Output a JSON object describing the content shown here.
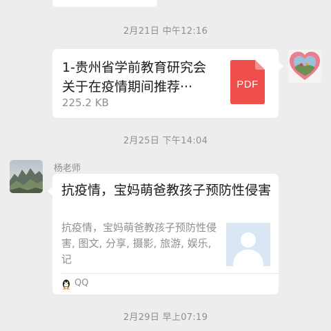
{
  "timestamps": {
    "t1": "2月21日 中午12:16",
    "t2": "2月25日 下午14:04",
    "t3": "2月29日 早上07:19"
  },
  "file_message": {
    "name_line1": "1-贵州省学前教育研究会",
    "name_line2": "关于在疫情期间推荐···",
    "size": "225.2 KB",
    "type_label": "PDF",
    "icon": "pdf-file-icon",
    "icon_color": "#f04e4a"
  },
  "link_message": {
    "sender": "杨老师",
    "title": "抗疫情，宝妈萌爸教孩子预防性侵害",
    "description": "抗疫情，宝妈萌爸教孩子预防性侵害, 图文, 分享, 摄影, 旅游, 娱乐, 记",
    "source": "QQ",
    "source_icon": "qq-penguin-icon",
    "thumbnail_icon": "default-avatar-icon"
  },
  "colors": {
    "background": "#ededed",
    "bubble": "#ffffff",
    "timestamp": "#8f8f8f"
  }
}
